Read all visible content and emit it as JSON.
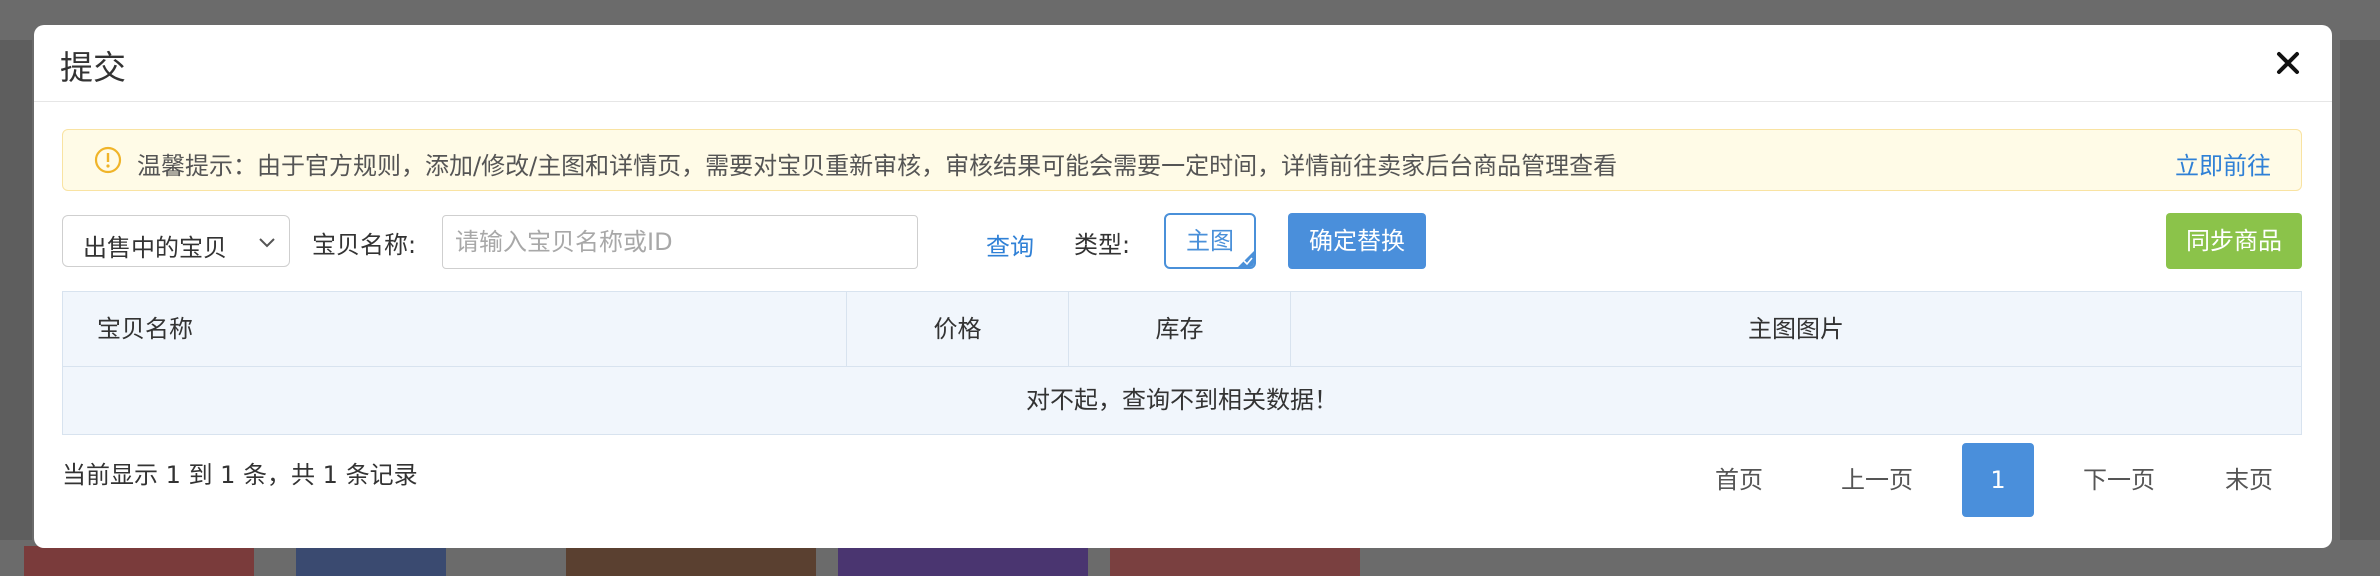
{
  "modal": {
    "title": "提交",
    "close_icon": "close-icon"
  },
  "notice": {
    "icon": "info-icon",
    "text": "温馨提示：由于官方规则，添加/修改/主图和详情页，需要对宝贝重新审核，审核结果可能会需要一定时间，详情前往卖家后台商品管理查看",
    "link": "立即前往"
  },
  "toolbar": {
    "status_select": "出售中的宝贝",
    "name_label": "宝贝名称:",
    "search_placeholder": "请输入宝贝名称或ID",
    "query_label": "查询",
    "type_label": "类型:",
    "type_value": "主图",
    "confirm_label": "确定替换",
    "sync_label": "同步商品"
  },
  "table": {
    "columns": [
      "宝贝名称",
      "价格",
      "库存",
      "主图图片"
    ],
    "empty_message": "对不起，查询不到相关数据！"
  },
  "footer": {
    "record_info": "当前显示 1 到 1 条，共 1 条记录",
    "pagination": {
      "first": "首页",
      "prev": "上一页",
      "current": "1",
      "next": "下一页",
      "last": "末页"
    }
  },
  "colors": {
    "accent": "#4a8fdb",
    "sync": "#8bc34a",
    "notice_bg": "#fffbe7",
    "notice_icon": "#f0b429",
    "overlay": "#6b6b6b"
  }
}
